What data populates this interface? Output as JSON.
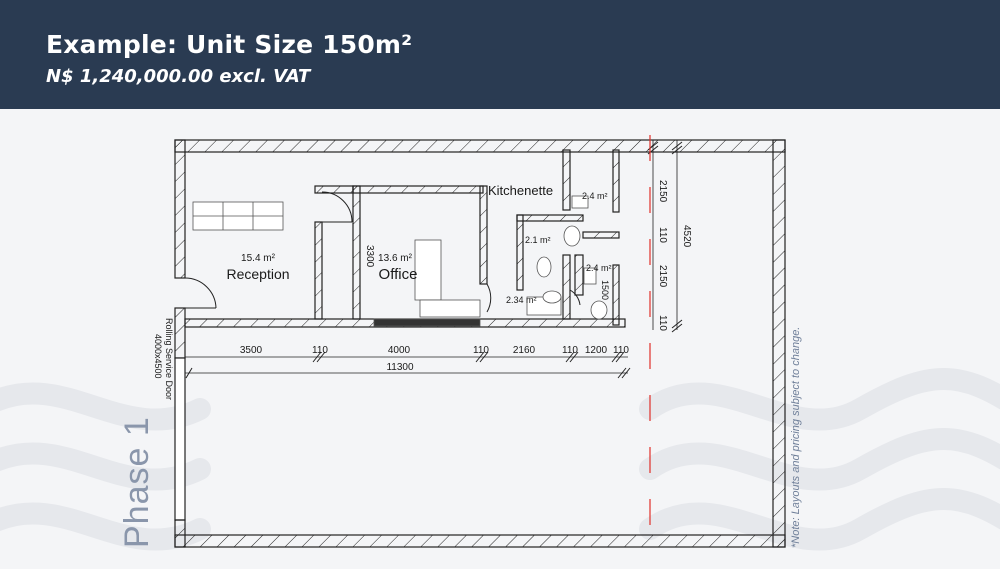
{
  "header": {
    "title": "Example: Unit Size 150m²",
    "price": "N$ 1,240,000.00 excl. VAT"
  },
  "phase_label": "Phase 1",
  "note": "*Note: Layouts and pricing subject to change.",
  "rooms": {
    "reception": {
      "area": "15.4 m²",
      "name": "Reception"
    },
    "office": {
      "area": "13.6 m²",
      "name": "Office",
      "dim": "3300"
    },
    "kitchenette": {
      "name": "Kitchenette",
      "area": "2.4 m²"
    },
    "wc1": {
      "area": "2.1 m²"
    },
    "wc2": {
      "area": "2.4 m²",
      "dim": "1500"
    },
    "wc3": {
      "area": "2.34 m²"
    }
  },
  "door_label": {
    "line1": "Rolling Service Door",
    "line2": "4000x4500"
  },
  "horizontal_dims": [
    "3500",
    "110",
    "4000",
    "110",
    "2160",
    "110",
    "1200",
    "110"
  ],
  "horizontal_total": "11300",
  "vertical_dims": [
    "2150",
    "110",
    "2150",
    "110"
  ],
  "vertical_total": "4520"
}
